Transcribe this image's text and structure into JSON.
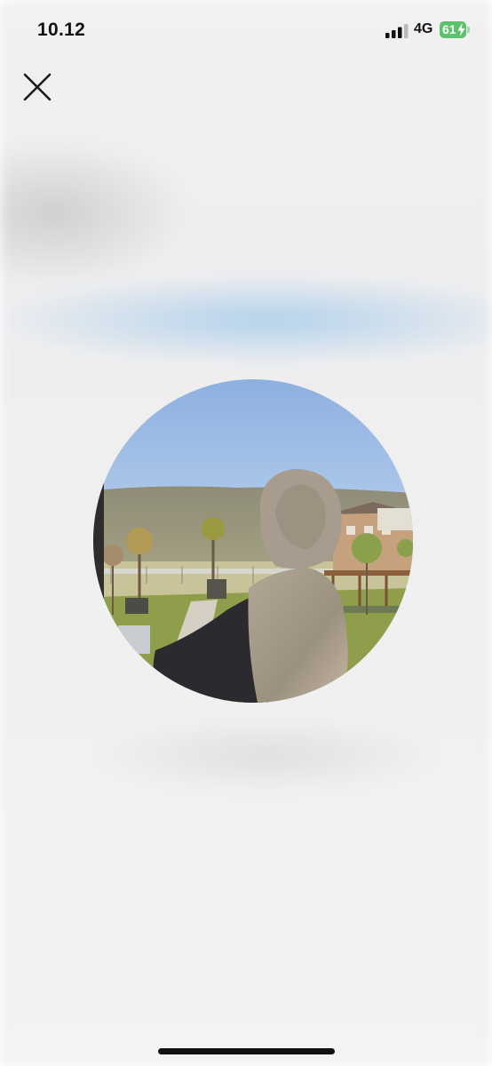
{
  "status_bar": {
    "time": "10.12",
    "network": "4G",
    "battery_level": "61",
    "signal_icon": "cellular-signal-icon",
    "battery_icon": "battery-charging-icon",
    "battery_color": "#5cc16b"
  },
  "toolbar": {
    "close_icon": "close-icon"
  },
  "profile": {
    "photo_description_icon": "profile-photo",
    "sky_color": "#9fc0e8",
    "scarf_color": "#a59a8c",
    "coat_color": "#2b2b2f"
  }
}
